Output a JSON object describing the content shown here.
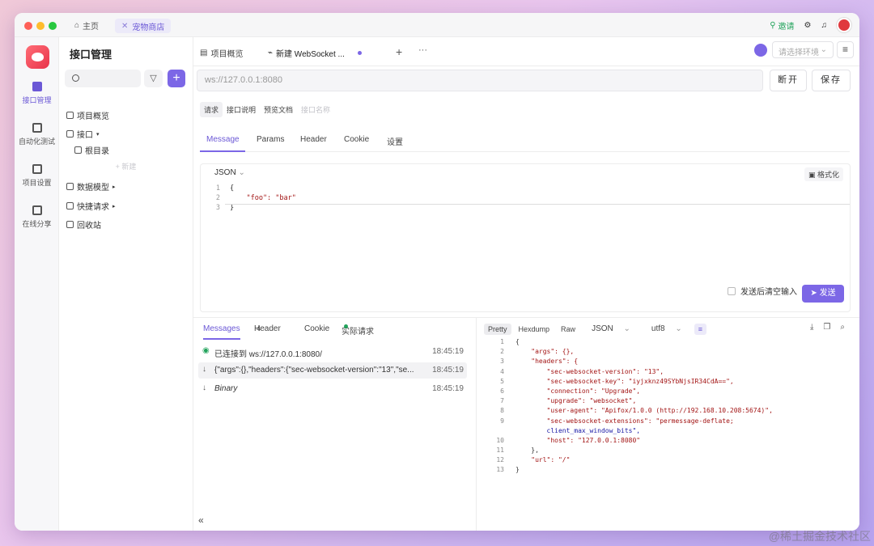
{
  "titlebar": {
    "home_tab": "主页",
    "project_tab": "宠物商店",
    "invite": "邀请"
  },
  "rail": {
    "items": [
      {
        "label": "接口管理",
        "icon": "api-icon"
      },
      {
        "label": "自动化测试",
        "icon": "automation-icon"
      },
      {
        "label": "项目设置",
        "icon": "settings-icon"
      },
      {
        "label": "在线分享",
        "icon": "share-icon"
      }
    ]
  },
  "side": {
    "title": "接口管理",
    "tree": {
      "overview": "项目概览",
      "api": "接口",
      "root": "根目录",
      "new": "+ 新建",
      "models": "数据模型",
      "quick": "快捷请求",
      "trash": "回收站"
    }
  },
  "tabs": {
    "overview": "项目概览",
    "new_ws": "新建 WebSocket ...",
    "env_placeholder": "请选择环境"
  },
  "request": {
    "url_placeholder": "ws://127.0.0.1:8080",
    "disconnect": "断开",
    "save": "保存",
    "subtabs": [
      "请求",
      "接口说明",
      "预览文档",
      "接口名称"
    ],
    "tabs": [
      "Message",
      "Params",
      "Header",
      "Cookie",
      "设置"
    ],
    "format": "JSON",
    "format_btn": "格式化",
    "body_lines": [
      "{",
      "    \"foo\": \"bar\"",
      "}"
    ],
    "clear_after_send": "发送后清空输入",
    "send": "发送"
  },
  "response": {
    "tabs": [
      "Messages",
      "Header",
      "Cookie",
      "实际请求"
    ],
    "header_count": "4",
    "messages": [
      {
        "icon": "check-circle-icon",
        "text": "已连接到 ws://127.0.0.1:8080/",
        "time": "18:45:19"
      },
      {
        "icon": "arrow-down-icon",
        "text": "{\"args\":{},\"headers\":{\"sec-websocket-version\":\"13\",\"se...",
        "time": "18:45:19"
      },
      {
        "icon": "arrow-down-icon",
        "text": "Binary",
        "time": "18:45:19"
      }
    ],
    "view_tabs": [
      "Pretty",
      "Hexdump",
      "Raw"
    ],
    "view_format": "JSON",
    "encoding": "utf8",
    "body": [
      "{",
      "    \"args\": {},",
      "    \"headers\": {",
      "        \"sec-websocket-version\": \"13\",",
      "        \"sec-websocket-key\": \"iyjxknz49SYbNjsIR34CdA==\",",
      "        \"connection\": \"Upgrade\",",
      "        \"upgrade\": \"websocket\",",
      "        \"user-agent\": \"Apifox/1.0.0 (http://192.168.10.208:5674)\",",
      "        \"sec-websocket-extensions\": \"permessage-deflate;",
      "        client_max_window_bits\",",
      "        \"host\": \"127.0.0.1:8080\"",
      "    },",
      "    \"url\": \"/\"",
      "}"
    ],
    "line_numbers": [
      "1",
      "2",
      "3",
      "4",
      "5",
      "6",
      "7",
      "8",
      "9",
      "",
      "10",
      "11",
      "12",
      "13"
    ]
  },
  "watermark": "@稀土掘金技术社区"
}
